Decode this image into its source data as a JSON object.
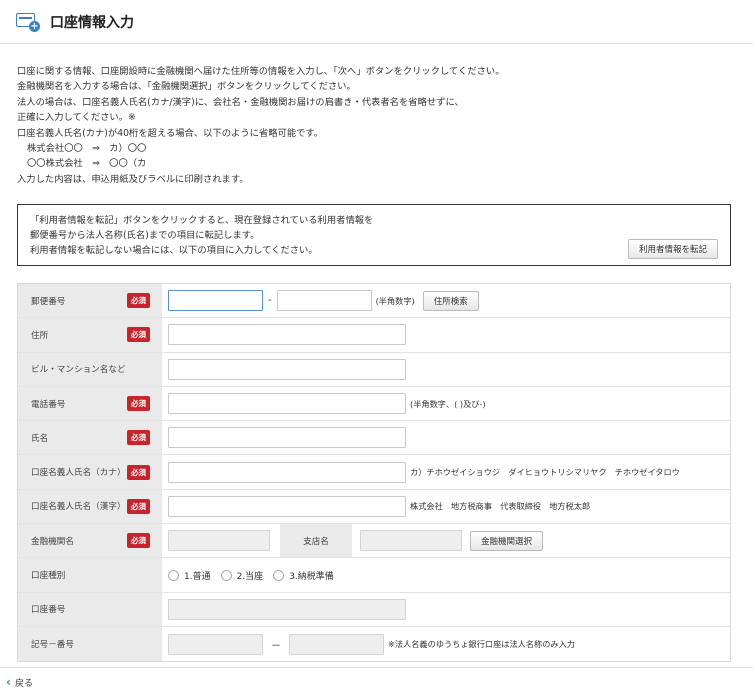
{
  "header": {
    "title": "口座情報入力"
  },
  "intro": {
    "lines": [
      "口座に関する情報、口座開設時に金融機関へ届けた住所等の情報を入力し、「次へ」ボタンをクリックしてください。",
      "金融機関名を入力する場合は、「金融機関選択」ボタンをクリックしてください。",
      "法人の場合は、口座名義人氏名(カナ/漢字)に、会社名・金融機関お届けの肩書き・代表者名を省略せずに、",
      "正確に入力してください。※",
      "口座名義人氏名(カナ)が40桁を超える場合、以下のように省略可能です。",
      "株式会社〇〇　⇒　カ）〇〇",
      "〇〇株式会社　⇒　〇〇（カ",
      "入力した内容は、申込用紙及びラベルに印刷されます。"
    ]
  },
  "transfer": {
    "lines": [
      "「利用者情報を転記」ボタンをクリックすると、現在登録されている利用者情報を",
      "郵便番号から法人名称(氏名)までの項目に転記します。",
      "利用者情報を転記しない場合には、以下の項目に入力してください。"
    ],
    "button": "利用者情報を転記"
  },
  "form": {
    "required": "必須",
    "postal": {
      "label": "郵便番号",
      "dash": "-",
      "hint": "(半角数字)",
      "search_button": "住所検索"
    },
    "address": {
      "label": "住所"
    },
    "building": {
      "label": "ビル・マンション名など"
    },
    "phone": {
      "label": "電話番号",
      "hint": "(半角数字、( )及び-)"
    },
    "name": {
      "label": "氏名"
    },
    "kana": {
      "label": "口座名義人氏名（カナ）",
      "hint": "カ）チホウゼイショウジ　ダイヒョウトリシマリヤク　チホウゼイタロウ"
    },
    "kanji": {
      "label": "口座名義人氏名（漢字）",
      "hint": "株式会社　地方税商事　代表取締役　地方税太郎"
    },
    "bank": {
      "label": "金融機関名",
      "branch_label": "支店名",
      "select_button": "金融機関選択"
    },
    "account_type": {
      "label": "口座種別",
      "options": [
        "1.普通",
        "2.当座",
        "3.納税準備"
      ]
    },
    "account_number": {
      "label": "口座番号"
    },
    "symbol": {
      "label": "記号－番号",
      "dash": "－",
      "hint": "※法人名義のゆうちょ銀行口座は法人名称のみ入力"
    }
  },
  "footer": {
    "back_label": "戻る"
  }
}
